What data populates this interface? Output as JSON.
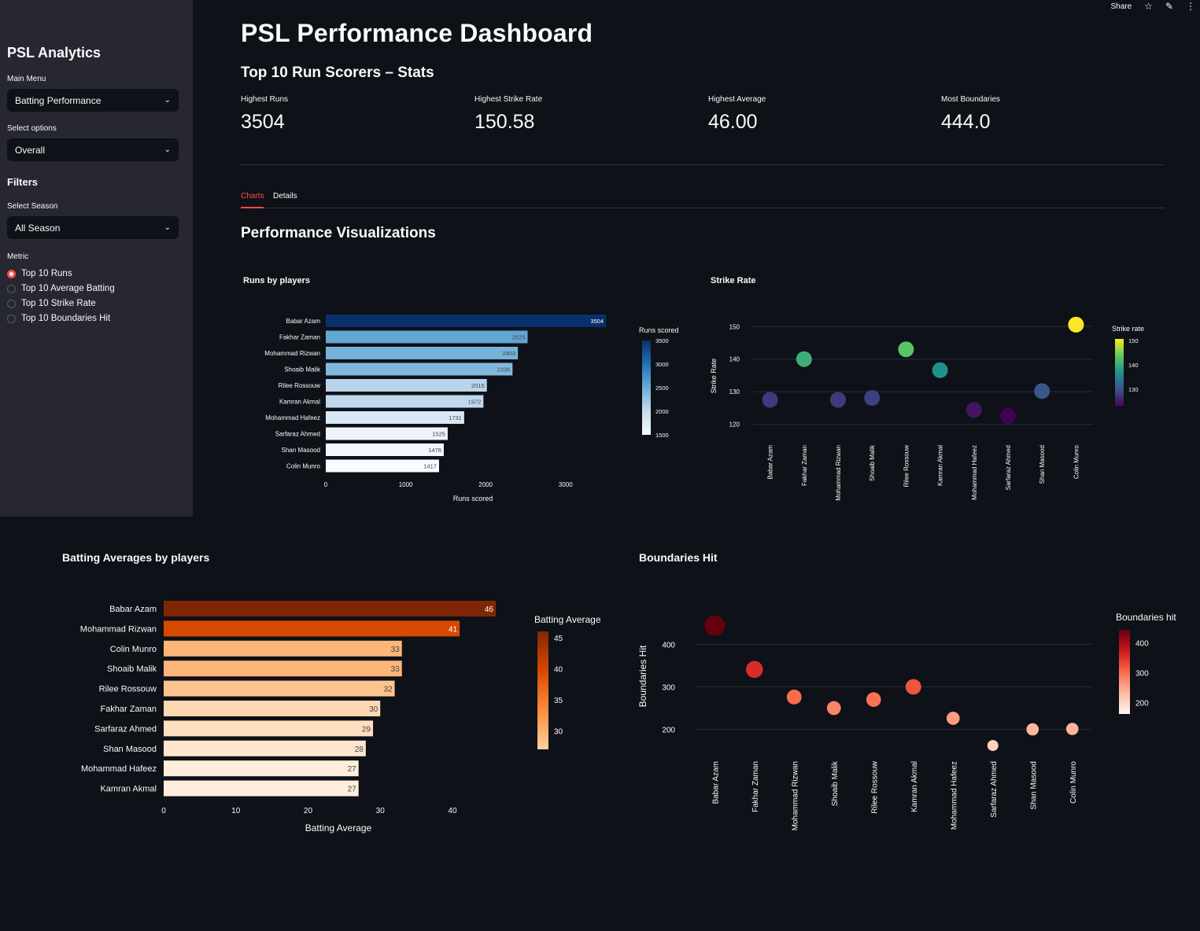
{
  "topbar": {
    "share": "Share"
  },
  "sidebar": {
    "title": "PSL Analytics",
    "main_menu_label": "Main Menu",
    "main_menu_value": "Batting Performance",
    "options_label": "Select options",
    "options_value": "Overall",
    "filters_heading": "Filters",
    "season_label": "Select Season",
    "season_value": "All Season",
    "metric_label": "Metric",
    "metric_options": [
      "Top 10 Runs",
      "Top 10 Average Batting",
      "Top 10 Strike Rate",
      "Top 10 Boundaries Hit"
    ],
    "metric_selected": 0
  },
  "header": {
    "title": "PSL Performance Dashboard",
    "subtitle": "Top 10 Run Scorers – Stats"
  },
  "metrics": [
    {
      "label": "Highest Runs",
      "value": "3504"
    },
    {
      "label": "Highest Strike Rate",
      "value": "150.58"
    },
    {
      "label": "Highest Average",
      "value": "46.00"
    },
    {
      "label": "Most Boundaries",
      "value": "444.0"
    }
  ],
  "tabs": [
    "Charts",
    "Details"
  ],
  "section_title": "Performance Visualizations",
  "chart_data": [
    {
      "type": "bar",
      "title": "Runs by players",
      "orientation": "horizontal",
      "categories": [
        "Babar Azam",
        "Fakhar Zaman",
        "Mohammad Rizwan",
        "Shoaib Malik",
        "Rilee Rossouw",
        "Kamran Akmal",
        "Mohammad Hafeez",
        "Sarfaraz Ahmed",
        "Shan Masood",
        "Colin Munro"
      ],
      "values": [
        3504,
        2525,
        2403,
        2336,
        2015,
        1972,
        1731,
        1525,
        1476,
        1417
      ],
      "xlabel": "Runs scored",
      "xlim": [
        0,
        3504
      ],
      "xticks": [
        0,
        1000,
        2000,
        3000
      ],
      "colorbar": {
        "title": "Runs scored",
        "ticks": [
          3500,
          3000,
          2500,
          2000,
          1500
        ],
        "scale": "Blues"
      }
    },
    {
      "type": "scatter",
      "title": "Strike Rate",
      "categories": [
        "Babar Azam",
        "Fakhar Zaman",
        "Mohammad Rizwan",
        "Shoaib Malik",
        "Rilee Rossouw",
        "Kamran Akmal",
        "Mohammad Hafeez",
        "Sarfaraz Ahmed",
        "Shan Masood",
        "Colin Munro"
      ],
      "values": [
        127.5,
        140.0,
        127.5,
        128.1,
        143.0,
        136.6,
        124.4,
        122.6,
        130.2,
        150.58
      ],
      "ylabel": "Strike Rate",
      "ylim": [
        117,
        152
      ],
      "yticks": [
        120,
        130,
        140,
        150
      ],
      "colorbar": {
        "title": "Strike rate",
        "ticks": [
          150,
          140,
          130
        ],
        "scale": "Viridis"
      }
    },
    {
      "type": "bar",
      "title": "Batting Averages by players",
      "orientation": "horizontal",
      "categories": [
        "Babar Azam",
        "Mohammad Rizwan",
        "Colin Munro",
        "Shoaib Malik",
        "Rilee Rossouw",
        "Fakhar Zaman",
        "Sarfaraz Ahmed",
        "Shan Masood",
        "Mohammad Hafeez",
        "Kamran Akmal"
      ],
      "values": [
        46,
        41,
        33,
        33,
        32,
        30,
        29,
        28,
        27,
        27
      ],
      "xlabel": "Batting Average",
      "xlim": [
        0,
        46
      ],
      "xticks": [
        0,
        10,
        20,
        30,
        40
      ],
      "colorbar": {
        "title": "Batting Average",
        "ticks": [
          45,
          40,
          35,
          30
        ],
        "scale": "Oranges"
      }
    },
    {
      "type": "scatter",
      "title": "Boundaries Hit",
      "categories": [
        "Babar Azam",
        "Fakhar Zaman",
        "Mohammad Rizwan",
        "Shoaib Malik",
        "Rilee Rossouw",
        "Kamran Akmal",
        "Mohammad Hafeez",
        "Sarfaraz Ahmed",
        "Shan Masood",
        "Colin Munro"
      ],
      "values": [
        444,
        341,
        276,
        250,
        270,
        300,
        226,
        162,
        200,
        201
      ],
      "ylabel": "Boundaries Hit",
      "ylim": [
        140,
        460
      ],
      "yticks": [
        200,
        300,
        400
      ],
      "colorbar": {
        "title": "Boundaries hit",
        "ticks": [
          400,
          300,
          200
        ],
        "scale": "Reds"
      }
    }
  ]
}
